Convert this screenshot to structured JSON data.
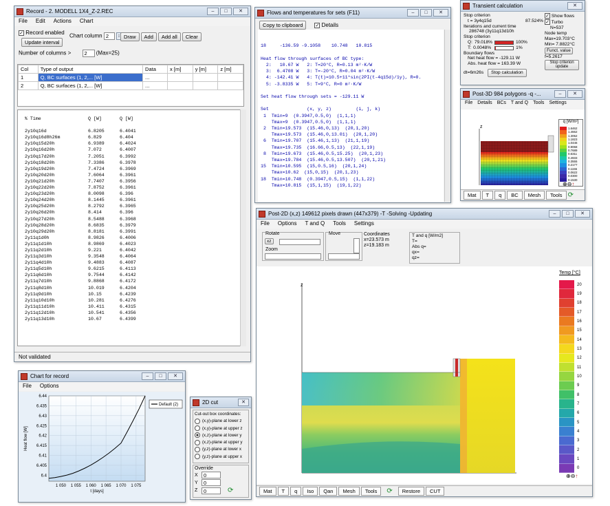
{
  "record": {
    "title": "Record - 2. MODELL 1X4_Z-2.REC",
    "menu": [
      "File",
      "Edit",
      "Actions",
      "Chart"
    ],
    "record_enabled": "Record enabled",
    "update_interval": "Update interval",
    "chart_column_label": "Chart column",
    "chart_column_value": "2",
    "buttons": [
      "Draw",
      "Add",
      "Add all",
      "Clear"
    ],
    "num_columns_label": "Number of columns  >",
    "num_columns_value": "2",
    "num_columns_max": "(Max=25)",
    "headers": [
      "Col",
      "Type of output",
      "Data",
      "x [m]",
      "y [m]",
      "z [m]"
    ],
    "rows": [
      {
        "col": "1",
        "type": "Q, BC surfaces (1, 2,... [W]",
        "data": "..."
      },
      {
        "col": "2",
        "type": "Q, BC surfaces (1, 2,... [W]",
        "data": "..."
      }
    ],
    "log_header": [
      "% Time",
      "Q [W]",
      "Q [W]"
    ],
    "log_rows": [
      [
        "2y10q16d",
        "6.8205",
        "6.4041"
      ],
      [
        "2y10q16d8h26m",
        "6.829",
        "6.404"
      ],
      [
        "2y10q15d20h",
        "6.9389",
        "6.4024"
      ],
      [
        "2y10q16d20h",
        "7.072",
        "6.4007"
      ],
      [
        "2y10q17d20h",
        "7.2051",
        "6.3992"
      ],
      [
        "2y10q18d20h",
        "7.3386",
        "6.3978"
      ],
      [
        "2y10q19d20h",
        "7.4724",
        "6.3969"
      ],
      [
        "2y10q20d20h",
        "7.6064",
        "6.3961"
      ],
      [
        "2y10q21d20h",
        "7.7407",
        "6.3956"
      ],
      [
        "2y10q22d20h",
        "7.8752",
        "6.3961"
      ],
      [
        "2y10q23d20h",
        "8.0098",
        "6.396"
      ],
      [
        "2y10q24d20h",
        "8.1445",
        "6.3961"
      ],
      [
        "2y10q25d20h",
        "8.2792",
        "6.3965"
      ],
      [
        "2y10q26d20h",
        "8.414",
        "6.396"
      ],
      [
        "2y10q27d20h",
        "8.5488",
        "6.3968"
      ],
      [
        "2y10q28d20h",
        "8.6835",
        "6.3979"
      ],
      [
        "2y10q29d20h",
        "8.8181",
        "6.3991"
      ],
      [
        "2y11q1d0h",
        "8.9826",
        "6.4006"
      ],
      [
        "2y11q1d10h",
        "8.9869",
        "6.4023"
      ],
      [
        "2y11q2d10h",
        "9.221",
        "6.4042"
      ],
      [
        "2y11q3d10h",
        "9.3548",
        "6.4064"
      ],
      [
        "2y11q4d10h",
        "9.4883",
        "6.4087"
      ],
      [
        "2y11q5d10h",
        "9.6215",
        "6.4113"
      ],
      [
        "2y11q6d10h",
        "9.7544",
        "6.4142"
      ],
      [
        "2y11q7d10h",
        "9.8868",
        "6.4172"
      ],
      [
        "2y11q8d10h",
        "10.019",
        "6.4204"
      ],
      [
        "2y11q9d10h",
        "10.15",
        "6.4239"
      ],
      [
        "2y11q10d10h",
        "10.281",
        "6.4276"
      ],
      [
        "2y11q11d10h",
        "10.411",
        "6.4315"
      ],
      [
        "2y11q12d10h",
        "10.541",
        "6.4356"
      ],
      [
        "2y11q13d10h",
        "10.67",
        "6.4399"
      ]
    ],
    "status": "Not validated"
  },
  "flows": {
    "title": "Flows and temperatures for sets (F11)",
    "copy_button": "Copy to clipboard",
    "details_label": "Details",
    "lines": [
      "18     -136.59 -9.1058    10.748   10.815",
      "",
      "Heat flow through surfaces of BC type:",
      "  2:   10.67 W   2: T=20°C, R=0.13 m²·K/W",
      "  3:  6.4708 W   3: T=-20°C, R=0.04 m²·K/W",
      "  4: -142.41 W   4: T(t)=10.5+11*sin(2PI(t-4q15d)/1y), R=0.",
      "  5: -3.8335 W   5: T=9°C, R=0 m²·K/W",
      "",
      "Set heat flow through sets = -129.11 W",
      "",
      "Set              (x, y, z)         (i, j, k)",
      " 1  Tmin=9  (0.3947,0.5,0)  (1,1,1)",
      "    Tmax=9  (0.3947,0.5,0)  (1,1,1)",
      " 2  Tmin=19.573  (15.46,0,13)  (20,1,20)",
      "    Tmax=19.573  (15.46,0,13.01)  (20,1,20)",
      " 6  Tmin=19.707  (15.46,1,13)  (21,1,19)",
      "    Tmax=19.735  (16.66,0.5,13)  (22,1,19)",
      " 8  Tmin=19.673  (15.46,0.5,15.25)  (20,1,23)",
      "    Tmax=19.784  (15.46,0.5,13.507)  (20,1,21)",
      "15  Tmin=10.595  (15,0.5,16)  (20,1,24)",
      "    Tmax=10.62  (15,0,15)  (20,1,23)",
      "18  Tmin=10.748  (0.3947,0.5,15)  (1,1,22)",
      "    Tmax=10.815  (15,1,15)  (19,1,22)"
    ]
  },
  "transient": {
    "title": "Transient calculation",
    "stop_criterion_label": "Stop criterion",
    "t_value": "t = 3y4q15d",
    "t_percent": "87.524%",
    "iter_label": "Iterations and current time",
    "iter_value": "286748 (3y11q13d10h",
    "q_label": "Q:",
    "q_value": "79.018%",
    "q_bar_value": 100,
    "q_bar_label": "100%",
    "t2_label": "T:",
    "t2_value": "0.0048%",
    "t2_bar_value": 1,
    "t2_bar_label": "1%",
    "boundary_label": "Boundary flows",
    "net_heat": "Net heat flow = -129.11 W",
    "abs_heat": "Abs. heat flow = 163.39 W",
    "dt": "dt=6m26s",
    "stop_button": "Stop calculation",
    "show_flows": "Show flows",
    "turbo": "Turbo",
    "n_value": "N=537",
    "node_temp_label": "Node temp",
    "max_temp": "Max=19.703°C",
    "min_temp": "Min= 7.8822°C",
    "funct_button": "Funct. value",
    "funct_value": "f=5.2617",
    "stop_update": "Stop criterion update"
  },
  "post3d": {
    "title": "Post-3D 984 polygons  -q -...",
    "menu": [
      "File",
      "Details",
      "BCs",
      "T and Q",
      "Tools",
      "Settings"
    ],
    "legend_title": "q [W/m²]",
    "legend_values": [
      "1.6462",
      "1.4662",
      "1.3052",
      "1.1823",
      "1.0446",
      "0.9068",
      "0.7689",
      "0.6311",
      "0.4933",
      "0.3555",
      "0.2177",
      "0.1155",
      "0.0622",
      "0.0300",
      "0.1530"
    ],
    "axis_z": "z",
    "tabs": [
      "Mat",
      "T",
      "q",
      "BC",
      "Mesh",
      "Tools"
    ]
  },
  "post2d": {
    "title": "Post-2D (x,z) 149612 pixels drawn (447x379) -T -Solving -Updating",
    "menu": [
      "File",
      "Options",
      "T and Q",
      "Tools",
      "Settings"
    ],
    "rotate_label": "Rotate",
    "xz_label": "xz",
    "zoom_label": "Zoom",
    "move_label": "Move",
    "coords_label": "Coordinates",
    "x_coord": "x=23.573 m",
    "z_coord": "z=19.183 m",
    "tq_label": "T and q [W/m2]",
    "tq_lines": [
      "T=",
      "Abs q=",
      "qx=",
      "qz="
    ],
    "axis_z": "z",
    "axis_x": "x",
    "legend_title": "Temp [°C]",
    "legend_values": [
      "20",
      "19",
      "18",
      "17",
      "16",
      "15",
      "14",
      "13",
      "12",
      "11",
      "10",
      "9",
      "8",
      "7",
      "6",
      "5",
      "4",
      "3",
      "2",
      "1",
      "0"
    ],
    "tabs": [
      "Mat",
      "T",
      "q",
      "Iso",
      "Qan",
      "Mesh",
      "Tools",
      "Restore",
      "CUT"
    ]
  },
  "chart": {
    "title": "Chart for record",
    "menu": [
      "File",
      "Options"
    ],
    "legend": "Default (2)"
  },
  "chart_data": {
    "type": "line",
    "ylabel": "Heat flow [W]",
    "xlabel": "t [days]",
    "xlim": [
      1046,
      1078
    ],
    "ylim": [
      6.397,
      6.44
    ],
    "xticks": [
      "1 050",
      "1 055",
      "1 060",
      "1 065",
      "1 070",
      "1 075"
    ],
    "xtick_values": [
      1050,
      1055,
      1060,
      1065,
      1070,
      1075
    ],
    "yticks": [
      "6.4",
      "6.405",
      "6.41",
      "6.415",
      "6.42",
      "6.425",
      "6.43",
      "6.435",
      "6.44"
    ],
    "ytick_values": [
      6.4,
      6.405,
      6.41,
      6.415,
      6.42,
      6.425,
      6.43,
      6.435,
      6.44
    ],
    "series": [
      {
        "name": "Default (2)",
        "x": [
          1046,
          1048,
          1050,
          1052,
          1054,
          1056,
          1058,
          1060,
          1062,
          1064,
          1066,
          1068,
          1070,
          1072,
          1074,
          1076,
          1078
        ],
        "y": [
          6.3985,
          6.3988,
          6.3994,
          6.4001,
          6.401,
          6.4022,
          6.4036,
          6.4052,
          6.407,
          6.409,
          6.4112,
          6.4136,
          6.4162,
          6.4218,
          6.4275,
          6.4335,
          6.44
        ]
      }
    ]
  },
  "cut2d": {
    "title": "2D cut",
    "group_label": "Cut-out box coordinates:",
    "options": [
      {
        "label": "(x,y)-plane at lower z",
        "on": false
      },
      {
        "label": "(x,y)-plane at upper z",
        "on": false
      },
      {
        "label": "(x,z)-plane at lower y",
        "on": true
      },
      {
        "label": "(x,z)-plane at upper y",
        "on": false
      },
      {
        "label": "(y,z)-plane at lower x",
        "on": false
      },
      {
        "label": "(y,z)-plane at upper x",
        "on": false
      }
    ],
    "override_label": "Override",
    "x_label": "X",
    "y_label": "Y",
    "z_label": "Z",
    "x_value": "0",
    "y_value": "0",
    "z_value": "0"
  }
}
